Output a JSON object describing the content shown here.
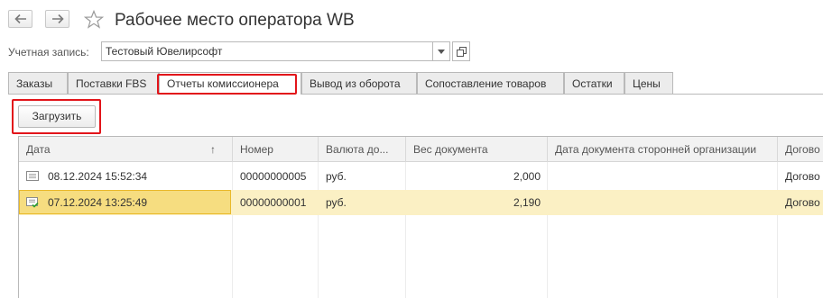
{
  "header": {
    "title": "Рабочее место оператора WB"
  },
  "account": {
    "label": "Учетная запись:",
    "value": "Тестовый Ювелирсофт"
  },
  "tabs": [
    {
      "label": "Заказы"
    },
    {
      "label": "Поставки FBS"
    },
    {
      "label": "Отчеты комиссионера"
    },
    {
      "label": "Вывод из оборота"
    },
    {
      "label": "Сопоставление товаров"
    },
    {
      "label": "Остатки"
    },
    {
      "label": "Цены"
    }
  ],
  "toolbar": {
    "load_label": "Загрузить"
  },
  "table": {
    "columns": [
      "Дата",
      "Номер",
      "Валюта до...",
      "Вес документа",
      "Дата документа сторонней организации",
      "Догово"
    ],
    "sort_indicator": "↑",
    "rows": [
      {
        "date": "08.12.2024 15:52:34",
        "number": "00000000005",
        "currency": "руб.",
        "weight": "2,000",
        "ext_date": "",
        "contract": "Догово"
      },
      {
        "date": "07.12.2024 13:25:49",
        "number": "00000000001",
        "currency": "руб.",
        "weight": "2,190",
        "ext_date": "",
        "contract": "Догово"
      }
    ]
  },
  "colors": {
    "highlight": "#e2141a",
    "selected_row": "#fbf0c4",
    "focused_cell": "#f6dd80"
  }
}
